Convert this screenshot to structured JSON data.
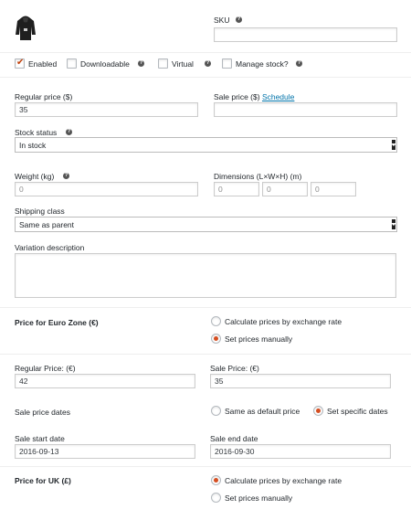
{
  "image": {
    "icon": "hoodie-product-thumbnail-icon"
  },
  "sku": {
    "label": "SKU",
    "value": ""
  },
  "options": {
    "enabled": {
      "label": "Enabled",
      "checked": true
    },
    "downloadable": {
      "label": "Downloadable",
      "checked": false
    },
    "virtual": {
      "label": "Virtual",
      "checked": false
    },
    "manage_stock": {
      "label": "Manage stock?",
      "checked": false
    }
  },
  "pricing": {
    "regular_label": "Regular price ($)",
    "regular_value": "35",
    "sale_label": "Sale price ($)",
    "schedule_link": "Schedule",
    "sale_value": ""
  },
  "stock": {
    "label": "Stock status",
    "value": "In stock"
  },
  "weight": {
    "label": "Weight (kg)",
    "placeholder": "0"
  },
  "dimensions": {
    "label": "Dimensions (L×W×H) (m)",
    "length_placeholder": "0",
    "width_placeholder": "0",
    "height_placeholder": "0"
  },
  "shipping": {
    "label": "Shipping class",
    "value": "Same as parent"
  },
  "description": {
    "label": "Variation description",
    "value": ""
  },
  "euro_zone": {
    "heading": "Price for Euro Zone (€)",
    "option_exchange": "Calculate prices by exchange rate",
    "option_manual": "Set prices manually",
    "selected": "manual",
    "regular_label": "Regular Price: (€)",
    "regular_value": "42",
    "sale_label": "Sale Price: (€)",
    "sale_value": "35",
    "dates_label": "Sale price dates",
    "dates_option_default": "Same as default price",
    "dates_option_specific": "Set specific dates",
    "dates_selected": "specific",
    "start_label": "Sale start date",
    "start_value": "2016-09-13",
    "end_label": "Sale end date",
    "end_value": "2016-09-30"
  },
  "uk": {
    "heading": "Price for UK (£)",
    "option_exchange": "Calculate prices by exchange rate",
    "option_manual": "Set prices manually",
    "selected": "exchange"
  },
  "colors": {
    "accent_check": "#c2410c",
    "radio_dot": "#d54e21",
    "link": "#0073aa"
  }
}
